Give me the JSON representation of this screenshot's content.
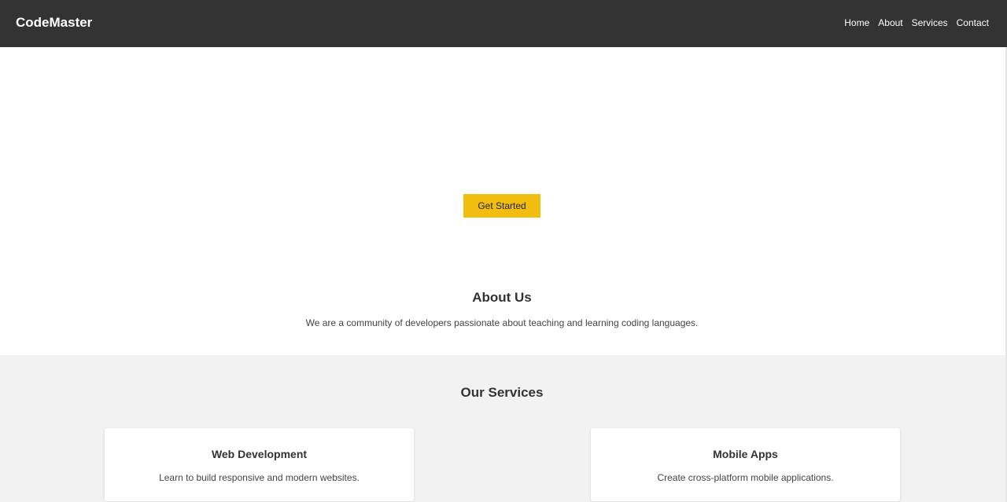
{
  "header": {
    "brand": "CodeMaster",
    "nav": [
      {
        "label": "Home"
      },
      {
        "label": "About"
      },
      {
        "label": "Services"
      },
      {
        "label": "Contact"
      }
    ],
    "background_color": "#333333"
  },
  "hero": {
    "cta_label": "Get Started",
    "cta_color": "#f1bd0e"
  },
  "about": {
    "title": "About Us",
    "text": "We are a community of developers passionate about teaching and learning coding languages."
  },
  "services": {
    "title": "Our Services",
    "background_color": "#f2f2f2",
    "cards": [
      {
        "title": "Web Development",
        "text": "Learn to build responsive and modern websites."
      },
      {
        "title": "Mobile Apps",
        "text": "Create cross-platform mobile applications."
      }
    ]
  }
}
